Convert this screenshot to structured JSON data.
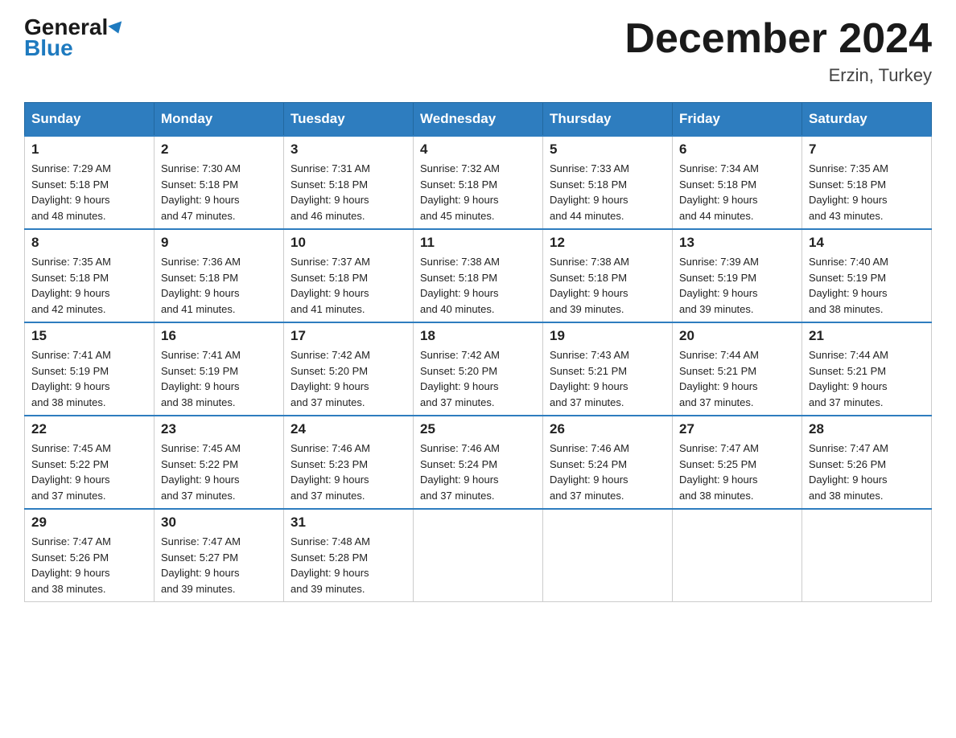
{
  "header": {
    "logo_general": "General",
    "logo_blue": "Blue",
    "month_title": "December 2024",
    "location": "Erzin, Turkey"
  },
  "days_of_week": [
    "Sunday",
    "Monday",
    "Tuesday",
    "Wednesday",
    "Thursday",
    "Friday",
    "Saturday"
  ],
  "weeks": [
    [
      {
        "day": "1",
        "sunrise": "7:29 AM",
        "sunset": "5:18 PM",
        "daylight": "9 hours and 48 minutes."
      },
      {
        "day": "2",
        "sunrise": "7:30 AM",
        "sunset": "5:18 PM",
        "daylight": "9 hours and 47 minutes."
      },
      {
        "day": "3",
        "sunrise": "7:31 AM",
        "sunset": "5:18 PM",
        "daylight": "9 hours and 46 minutes."
      },
      {
        "day": "4",
        "sunrise": "7:32 AM",
        "sunset": "5:18 PM",
        "daylight": "9 hours and 45 minutes."
      },
      {
        "day": "5",
        "sunrise": "7:33 AM",
        "sunset": "5:18 PM",
        "daylight": "9 hours and 44 minutes."
      },
      {
        "day": "6",
        "sunrise": "7:34 AM",
        "sunset": "5:18 PM",
        "daylight": "9 hours and 44 minutes."
      },
      {
        "day": "7",
        "sunrise": "7:35 AM",
        "sunset": "5:18 PM",
        "daylight": "9 hours and 43 minutes."
      }
    ],
    [
      {
        "day": "8",
        "sunrise": "7:35 AM",
        "sunset": "5:18 PM",
        "daylight": "9 hours and 42 minutes."
      },
      {
        "day": "9",
        "sunrise": "7:36 AM",
        "sunset": "5:18 PM",
        "daylight": "9 hours and 41 minutes."
      },
      {
        "day": "10",
        "sunrise": "7:37 AM",
        "sunset": "5:18 PM",
        "daylight": "9 hours and 41 minutes."
      },
      {
        "day": "11",
        "sunrise": "7:38 AM",
        "sunset": "5:18 PM",
        "daylight": "9 hours and 40 minutes."
      },
      {
        "day": "12",
        "sunrise": "7:38 AM",
        "sunset": "5:18 PM",
        "daylight": "9 hours and 39 minutes."
      },
      {
        "day": "13",
        "sunrise": "7:39 AM",
        "sunset": "5:19 PM",
        "daylight": "9 hours and 39 minutes."
      },
      {
        "day": "14",
        "sunrise": "7:40 AM",
        "sunset": "5:19 PM",
        "daylight": "9 hours and 38 minutes."
      }
    ],
    [
      {
        "day": "15",
        "sunrise": "7:41 AM",
        "sunset": "5:19 PM",
        "daylight": "9 hours and 38 minutes."
      },
      {
        "day": "16",
        "sunrise": "7:41 AM",
        "sunset": "5:19 PM",
        "daylight": "9 hours and 38 minutes."
      },
      {
        "day": "17",
        "sunrise": "7:42 AM",
        "sunset": "5:20 PM",
        "daylight": "9 hours and 37 minutes."
      },
      {
        "day": "18",
        "sunrise": "7:42 AM",
        "sunset": "5:20 PM",
        "daylight": "9 hours and 37 minutes."
      },
      {
        "day": "19",
        "sunrise": "7:43 AM",
        "sunset": "5:21 PM",
        "daylight": "9 hours and 37 minutes."
      },
      {
        "day": "20",
        "sunrise": "7:44 AM",
        "sunset": "5:21 PM",
        "daylight": "9 hours and 37 minutes."
      },
      {
        "day": "21",
        "sunrise": "7:44 AM",
        "sunset": "5:21 PM",
        "daylight": "9 hours and 37 minutes."
      }
    ],
    [
      {
        "day": "22",
        "sunrise": "7:45 AM",
        "sunset": "5:22 PM",
        "daylight": "9 hours and 37 minutes."
      },
      {
        "day": "23",
        "sunrise": "7:45 AM",
        "sunset": "5:22 PM",
        "daylight": "9 hours and 37 minutes."
      },
      {
        "day": "24",
        "sunrise": "7:46 AM",
        "sunset": "5:23 PM",
        "daylight": "9 hours and 37 minutes."
      },
      {
        "day": "25",
        "sunrise": "7:46 AM",
        "sunset": "5:24 PM",
        "daylight": "9 hours and 37 minutes."
      },
      {
        "day": "26",
        "sunrise": "7:46 AM",
        "sunset": "5:24 PM",
        "daylight": "9 hours and 37 minutes."
      },
      {
        "day": "27",
        "sunrise": "7:47 AM",
        "sunset": "5:25 PM",
        "daylight": "9 hours and 38 minutes."
      },
      {
        "day": "28",
        "sunrise": "7:47 AM",
        "sunset": "5:26 PM",
        "daylight": "9 hours and 38 minutes."
      }
    ],
    [
      {
        "day": "29",
        "sunrise": "7:47 AM",
        "sunset": "5:26 PM",
        "daylight": "9 hours and 38 minutes."
      },
      {
        "day": "30",
        "sunrise": "7:47 AM",
        "sunset": "5:27 PM",
        "daylight": "9 hours and 39 minutes."
      },
      {
        "day": "31",
        "sunrise": "7:48 AM",
        "sunset": "5:28 PM",
        "daylight": "9 hours and 39 minutes."
      },
      null,
      null,
      null,
      null
    ]
  ]
}
